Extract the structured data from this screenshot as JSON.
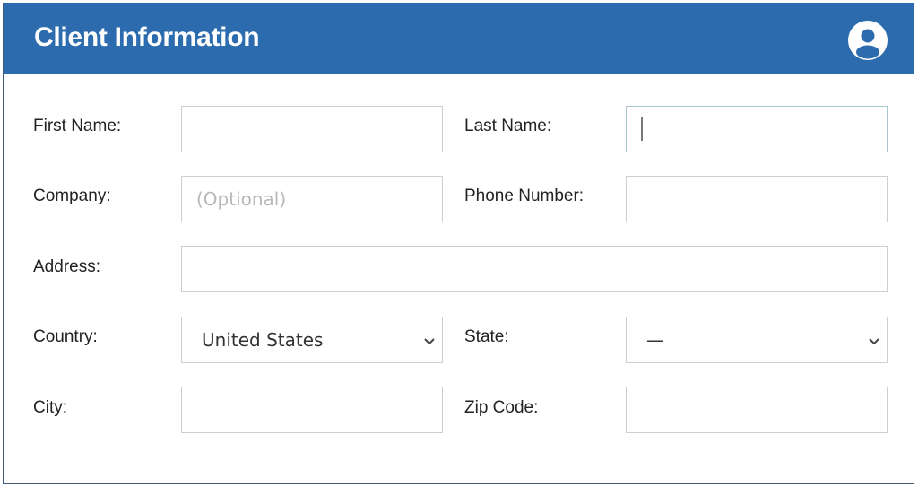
{
  "header": {
    "title": "Client Information",
    "avatar_icon": "user-circle-icon",
    "accent_color": "#2c6bae"
  },
  "form": {
    "first_name": {
      "label": "First Name:",
      "value": "",
      "placeholder": ""
    },
    "last_name": {
      "label": "Last Name:",
      "value": "",
      "placeholder": "",
      "focused": true
    },
    "company": {
      "label": "Company:",
      "value": "",
      "placeholder": "(Optional)"
    },
    "phone_number": {
      "label": "Phone Number:",
      "value": "",
      "placeholder": ""
    },
    "address": {
      "label": "Address:",
      "value": "",
      "placeholder": ""
    },
    "country": {
      "label": "Country:",
      "selected": "United States"
    },
    "state": {
      "label": "State:",
      "selected": "—"
    },
    "city": {
      "label": "City:",
      "value": "",
      "placeholder": ""
    },
    "zip_code": {
      "label": "Zip Code:",
      "value": "",
      "placeholder": ""
    }
  }
}
